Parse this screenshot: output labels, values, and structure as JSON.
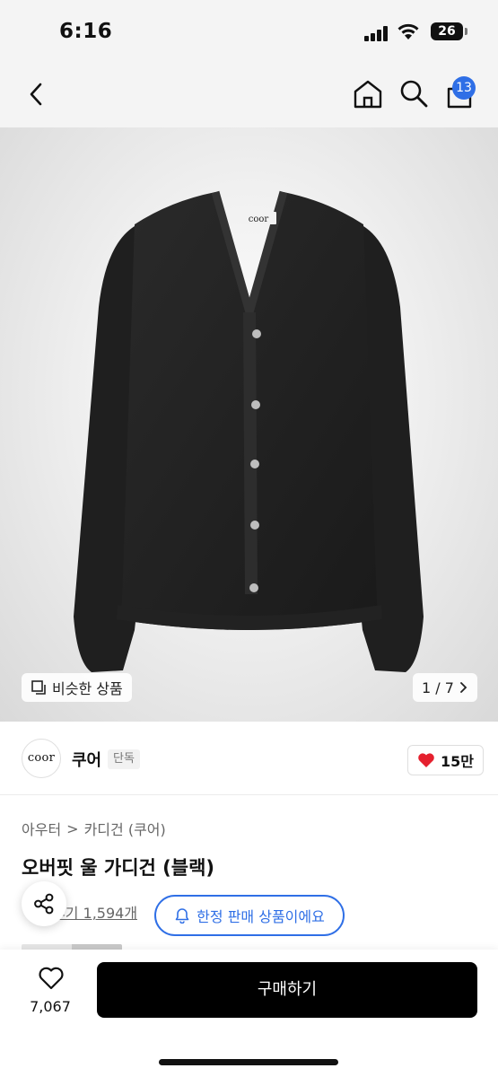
{
  "status": {
    "time": "6:16",
    "battery": "26"
  },
  "nav": {
    "cart_count": "13"
  },
  "gallery": {
    "similar_label": "비슷한 상품",
    "pager": "1 / 7",
    "garment_tag": "coor"
  },
  "brand": {
    "logo_text": "coor",
    "name": "쿠어",
    "tag": "단독",
    "likes": "15만"
  },
  "breadcrumb": {
    "category": "아우터",
    "separator": ">",
    "subcategory": "카디건 (쿠어)"
  },
  "product": {
    "title": "오버핏 울 가디건 (블랙)",
    "reviews": "후기 1,594개"
  },
  "limited_label": "한정 판매 상품이에요",
  "bottom": {
    "wish_count": "7,067",
    "buy_label": "구매하기"
  },
  "colors": {
    "accent": "#2f6fe6",
    "heart": "#e5202e",
    "buy_bg": "#000000"
  },
  "icons": [
    "chevron-left-icon",
    "home-icon",
    "search-icon",
    "cart-icon",
    "similar-icon",
    "chevron-right-icon",
    "heart-icon",
    "share-icon",
    "bell-icon",
    "heart-outline-icon"
  ]
}
